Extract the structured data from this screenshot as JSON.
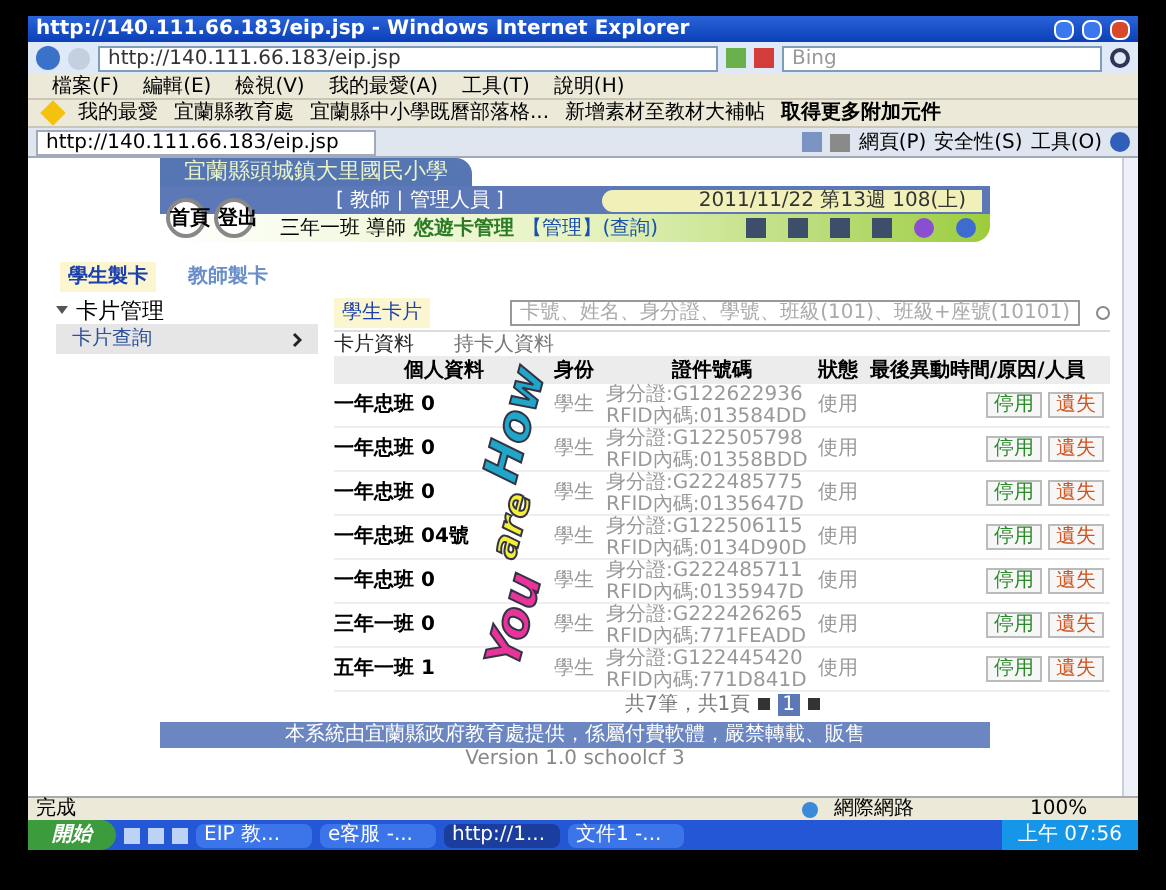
{
  "window": {
    "title": "http://140.111.66.183/eip.jsp - Windows Internet Explorer",
    "address": "http://140.111.66.183/eip.jsp",
    "search_placeholder": "Bing",
    "menu": [
      "檔案(F)",
      "編輯(E)",
      "檢視(V)",
      "我的最愛(A)",
      "工具(T)",
      "說明(H)"
    ],
    "favorites_label": "我的最愛",
    "favorites": [
      "宜蘭縣教育處",
      "宜蘭縣中小學既曆部落格...",
      "新增素材至教材大補帖",
      "取得更多附加元件"
    ],
    "tab_title": "http://140.111.66.183/eip.jsp",
    "toolbar": [
      "網頁(P)",
      "安全性(S)",
      "工具(O)"
    ]
  },
  "page": {
    "school_name": "宜蘭縣頭城鎮大里國民小學",
    "nav_buttons": [
      "首頁",
      "登出"
    ],
    "roles": "[ 教師 | 管理人員 ]",
    "date": "2011/11/22 第13週 108(上)",
    "user": "三年一班 導師",
    "module": "悠遊卡管理",
    "module_links": "【管理】(查詢)",
    "card_tabs": [
      {
        "label": "學生製卡",
        "selected": true
      },
      {
        "label": "教師製卡",
        "selected": false
      }
    ],
    "sidebar": {
      "group": "卡片管理",
      "expanded": true,
      "items": [
        {
          "label": "卡片查詢",
          "selected": true
        }
      ]
    },
    "panel": {
      "title": "學生卡片",
      "search_placeholder": "卡號、姓名、身分證、學號、班級(101)、班級+座號(10101)",
      "subtabs": [
        {
          "label": "卡片資料",
          "selected": true
        },
        {
          "label": "持卡人資料",
          "selected": false
        }
      ],
      "columns": [
        "個人資料",
        "身份",
        "證件號碼",
        "狀態",
        "最後異動時間/原因/人員"
      ],
      "rows": [
        {
          "name": "一年忠班 0",
          "role": "學生",
          "id_no": "身分證:G122622936",
          "rfid": "RFID內碼:013584DD",
          "status": "使用",
          "actions": [
            "停用",
            "遺失"
          ]
        },
        {
          "name": "一年忠班 0",
          "role": "學生",
          "id_no": "身分證:G122505798",
          "rfid": "RFID內碼:01358BDD",
          "status": "使用",
          "actions": [
            "停用",
            "遺失"
          ]
        },
        {
          "name": "一年忠班 0",
          "role": "學生",
          "id_no": "身分證:G222485775",
          "rfid": "RFID內碼:0135647D",
          "status": "使用",
          "actions": [
            "停用",
            "遺失"
          ]
        },
        {
          "name": "一年忠班 04號",
          "role": "學生",
          "id_no": "身分證:G122506115",
          "rfid": "RFID內碼:0134D90D",
          "status": "使用",
          "actions": [
            "停用",
            "遺失"
          ]
        },
        {
          "name": "一年忠班 0",
          "role": "學生",
          "id_no": "身分證:G222485711",
          "rfid": "RFID內碼:0135947D",
          "status": "使用",
          "actions": [
            "停用",
            "遺失"
          ]
        },
        {
          "name": "三年一班 0",
          "role": "學生",
          "id_no": "身分證:G222426265",
          "rfid": "RFID內碼:771FEADD",
          "status": "使用",
          "actions": [
            "停用",
            "遺失"
          ]
        },
        {
          "name": "五年一班 1",
          "role": "學生",
          "id_no": "身分證:G122445420",
          "rfid": "RFID內碼:771D841D",
          "status": "使用",
          "actions": [
            "停用",
            "遺失"
          ]
        }
      ],
      "pager": {
        "summary": "共7筆，共1頁",
        "pages": [
          {
            "label": "1",
            "selected": true
          }
        ]
      }
    },
    "sticker": [
      "How",
      "are",
      "You"
    ],
    "footer": "本系統由宜蘭縣政府教育處提供，係屬付費軟體，嚴禁轉載、販售",
    "version": "Version 1.0 schoolcf 3"
  },
  "status_bar": {
    "text": "完成",
    "zone": "網際網路",
    "zoom": "100%"
  },
  "taskbar": {
    "start": "開始",
    "tasks": [
      {
        "label": "EIP 教...",
        "selected": false
      },
      {
        "label": "e客服 -...",
        "selected": false
      },
      {
        "label": "http://1...",
        "selected": true
      },
      {
        "label": "文件1 -...",
        "selected": false
      }
    ],
    "clock": "上午 07:56"
  }
}
